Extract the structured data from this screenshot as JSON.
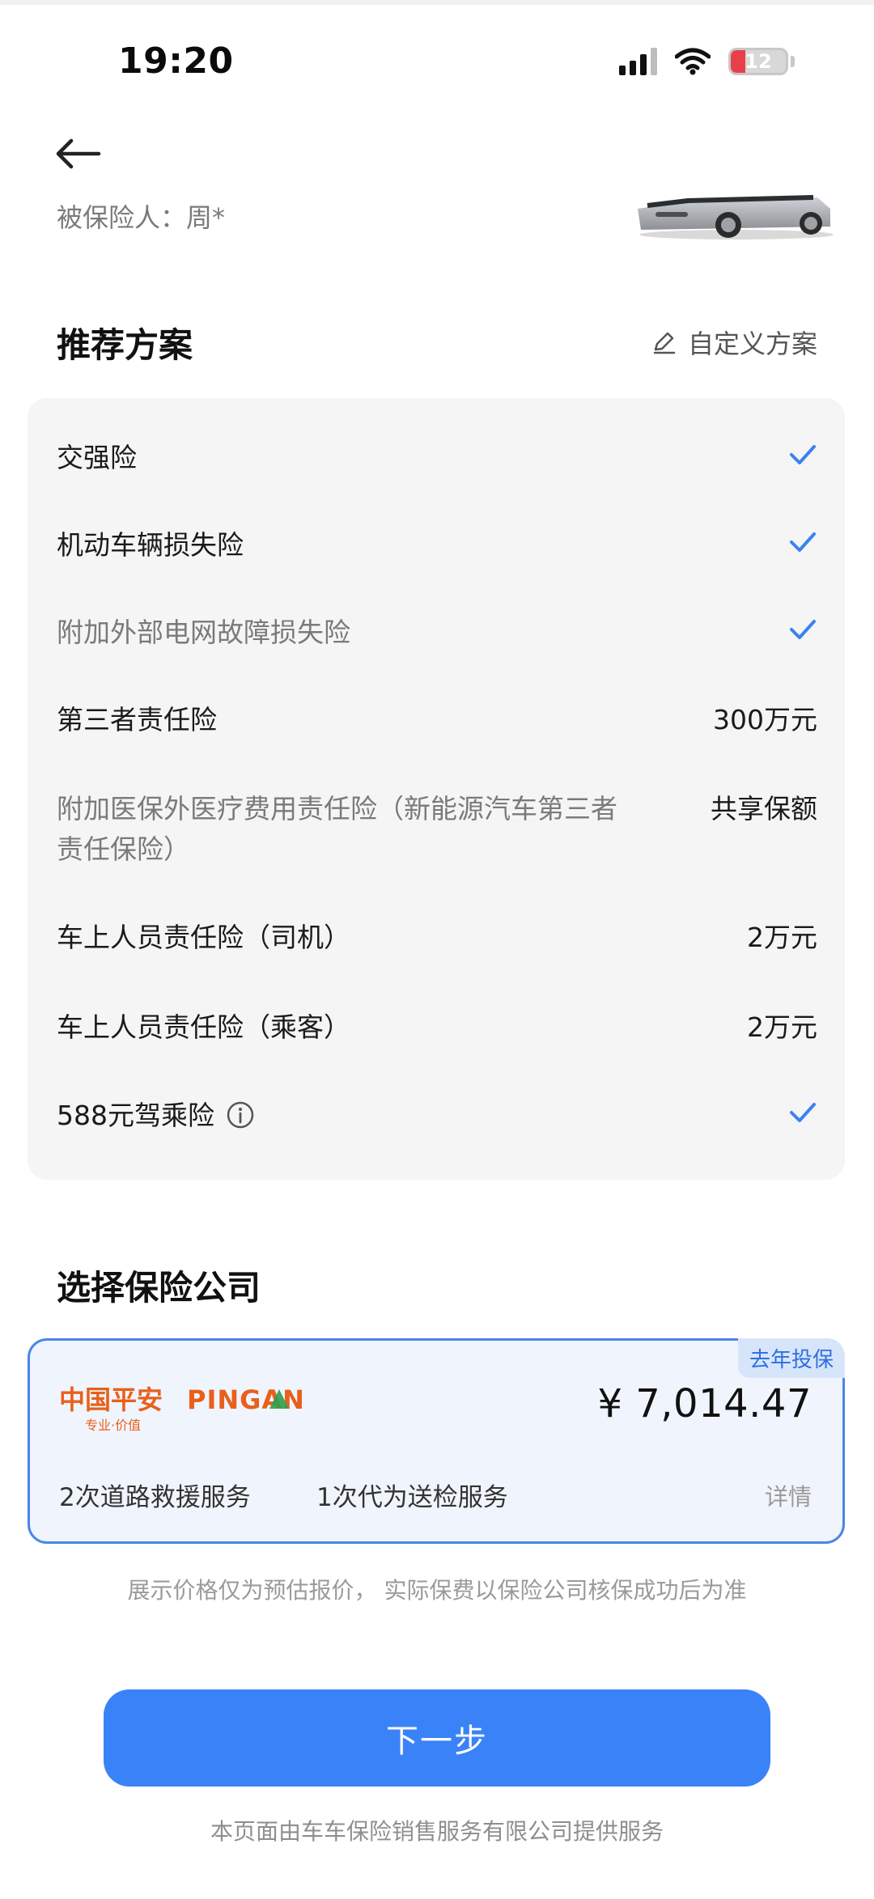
{
  "status_bar": {
    "time": "19:20",
    "battery_level": "12",
    "battery_fraction": 0.12
  },
  "header": {
    "insured_label": "被保险人：周*"
  },
  "recommended": {
    "title": "推荐方案",
    "custom_label": "自定义方案",
    "items": [
      {
        "name": "交强险",
        "value": "",
        "checked": true,
        "muted": false
      },
      {
        "name": "机动车辆损失险",
        "value": "",
        "checked": true,
        "muted": false
      },
      {
        "name": "附加外部电网故障损失险",
        "value": "",
        "checked": true,
        "muted": true
      },
      {
        "name": "第三者责任险",
        "value": "300万元",
        "checked": false,
        "muted": false
      },
      {
        "name": "附加医保外医疗费用责任险（新能源汽车第三者责任保险）",
        "name_line1": "附加医保外医疗费用责任险（新能源汽车第三者",
        "name_line2": "责任保险）",
        "value": "共享保额",
        "checked": false,
        "muted": true
      },
      {
        "name": "车上人员责任险（司机）",
        "value": "2万元",
        "checked": false,
        "muted": false
      },
      {
        "name": "车上人员责任险（乘客）",
        "value": "2万元",
        "checked": false,
        "muted": false
      },
      {
        "name": "588元驾乘险",
        "value": "",
        "checked": true,
        "muted": false
      }
    ]
  },
  "company": {
    "title": "选择保险公司",
    "badge": "去年投保",
    "logo_text_cn": "中国平安",
    "logo_text_en": "PINGAN",
    "logo_tagline": "专业·价值",
    "price": "¥ 7,014.47",
    "services": [
      "2次道路救援服务",
      "1次代为送检服务"
    ],
    "details_label": "详情"
  },
  "disclaimer": "展示价格仅为预估报价， 实际保费以保险公司核保成功后为准",
  "next_button": "下一步",
  "footer": "本页面由车车保险销售服务有限公司提供服务",
  "colors": {
    "accent": "#3a82f7",
    "check": "#3b82f0",
    "logo_orange": "#e8601c"
  }
}
